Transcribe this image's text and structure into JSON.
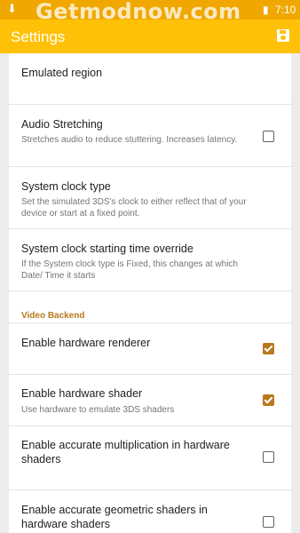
{
  "statusbar": {
    "watermark": "Getmodnow.com",
    "time": "7:10"
  },
  "appbar": {
    "title": "Settings"
  },
  "settings": {
    "emulated_region": {
      "title": "Emulated region"
    },
    "audio_stretching": {
      "title": "Audio Stretching",
      "summary": "Stretches audio to reduce stuttering. Increases latency.",
      "checked": false
    },
    "system_clock_type": {
      "title": "System clock type",
      "summary": "Set the simulated 3DS's clock to either reflect that of your device or start at a fixed point."
    },
    "clock_override": {
      "title": "System clock starting time override",
      "summary": "If the System clock type is Fixed, this changes at which Date/ Time it starts"
    },
    "video_header": "Video Backend",
    "hw_renderer": {
      "title": "Enable hardware renderer",
      "checked": true
    },
    "hw_shader": {
      "title": "Enable hardware shader",
      "summary": "Use hardware to emulate 3DS shaders",
      "checked": true
    },
    "accurate_mul": {
      "title": "Enable accurate multiplication in hardware shaders",
      "checked": false
    },
    "accurate_geo": {
      "title": "Enable accurate geometric shaders in hardware shaders",
      "checked": false
    }
  },
  "colors": {
    "statusbar": "#f0a800",
    "appbar": "#ffc107",
    "accent": "#b8791d"
  }
}
